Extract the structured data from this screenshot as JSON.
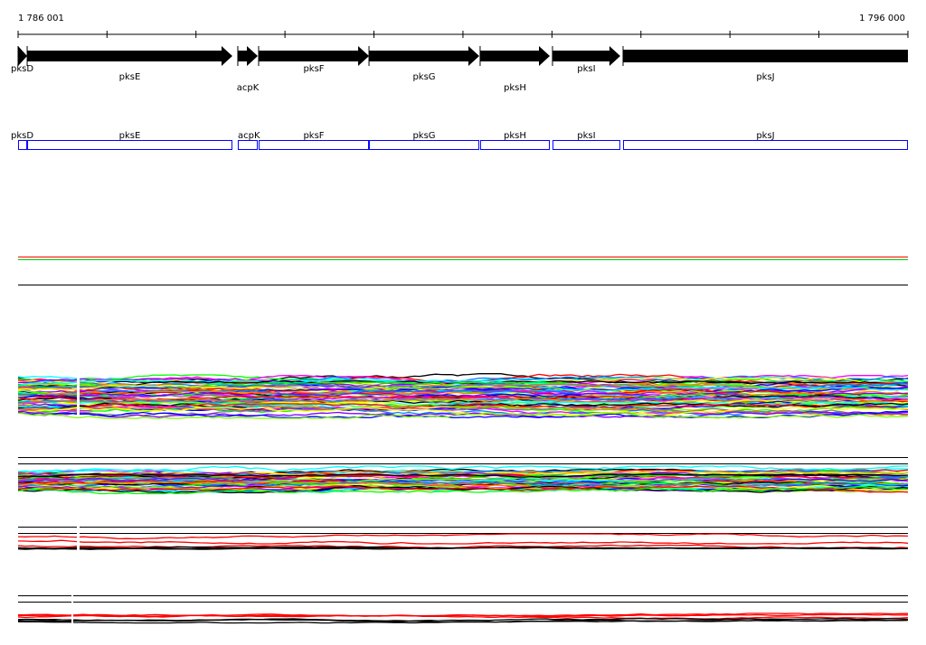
{
  "ruler": {
    "start": 1786001,
    "end": 1796000,
    "start_label": "1 786 001",
    "end_label": "1 796 000",
    "tick_interval_bp": 1000
  },
  "genes": [
    {
      "name": "pksD",
      "start": 1786001,
      "end": 1786103,
      "label_row": 0
    },
    {
      "name": "pksE",
      "start": 1786103,
      "end": 1788409,
      "label_row": 1
    },
    {
      "name": "acpK",
      "start": 1788470,
      "end": 1788694,
      "label_row": 2
    },
    {
      "name": "pksF",
      "start": 1788704,
      "end": 1789944,
      "label_row": 0
    },
    {
      "name": "pksG",
      "start": 1789944,
      "end": 1791183,
      "label_row": 1
    },
    {
      "name": "pksH",
      "start": 1791193,
      "end": 1791976,
      "label_row": 2
    },
    {
      "name": "pksI",
      "start": 1792006,
      "end": 1792768,
      "label_row": 0
    },
    {
      "name": "pksJ",
      "start": 1792799,
      "end": 1796000,
      "label_row": 1
    }
  ],
  "colors": {
    "gene_arrow": "#000000",
    "gene_box": "#0000ff",
    "track_line_1": "#ff0000",
    "track_line_2": "#00cc00",
    "palette": [
      "#00ffff",
      "#000000",
      "#ff0000",
      "#00ff00",
      "#ff00ff",
      "#0080ff",
      "#ff8000",
      "#808080",
      "#ffff00",
      "#8000ff",
      "#0000ff",
      "#80ff00"
    ]
  }
}
